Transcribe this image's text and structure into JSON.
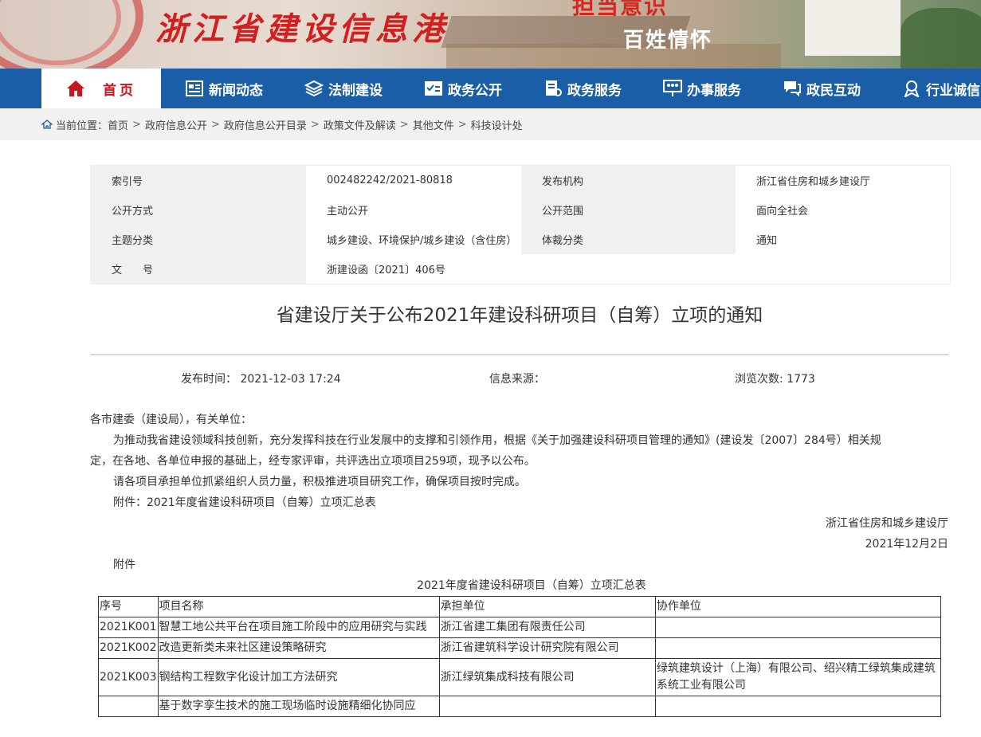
{
  "site": {
    "title": "浙江省建设信息港",
    "slogan_top": "担当意识",
    "slogan_bottom": "百姓情怀"
  },
  "nav": {
    "items": [
      {
        "label": "首页",
        "icon": "home-icon",
        "active": true
      },
      {
        "label": "新闻动态",
        "icon": "newspaper-icon"
      },
      {
        "label": "法制建设",
        "icon": "layers-icon"
      },
      {
        "label": "政务公开",
        "icon": "checklist-icon"
      },
      {
        "label": "政务服务",
        "icon": "document-icon"
      },
      {
        "label": "办事服务",
        "icon": "people-icon"
      },
      {
        "label": "政民互动",
        "icon": "chat-icon"
      },
      {
        "label": "行业诚信",
        "icon": "badge-icon"
      }
    ]
  },
  "breadcrumb": {
    "prefix": "当前位置：",
    "items": [
      "首页",
      "政府信息公开",
      "政府信息公开目录",
      "政策文件及解读",
      "其他文件",
      "科技设计处"
    ]
  },
  "meta": {
    "index_label": "索引号",
    "index_value": "002482242/2021-80818",
    "org_label": "发布机构",
    "org_value": "浙江省住房和城乡建设厅",
    "mode_label": "公开方式",
    "mode_value": "主动公开",
    "scope_label": "公开范围",
    "scope_value": "面向全社会",
    "topic_label": "主题分类",
    "topic_value": "城乡建设、环境保护/城乡建设（含住房）",
    "genre_label": "体裁分类",
    "genre_value": "通知",
    "docno_label": "文　　号",
    "docno_value": "浙建设函〔2021〕406号"
  },
  "article": {
    "title": "省建设厅关于公布2021年建设科研项目（自筹）立项的通知",
    "publish_time": "发布时间： 2021-12-03 17:24",
    "source": "信息来源：",
    "views": "浏览次数: 1773",
    "greeting": "各市建委（建设局），有关单位：",
    "p1a": "为推动我省建设领域科技创新，充分发挥科技在行业发展中的支撑和引领作用，根据《关于加强建设科研项目管理的通知》(建设发〔2007〕284号）相关规",
    "p1b": "定，在各地、各单位申报的基础上，经专家评审，共评选出立项项目259项，现予以公布。",
    "p2": "请各项目承担单位抓紧组织人员力量，积极推进项目研究工作，确保项目按时完成。",
    "p3": "附件：2021年度省建设科研项目（自筹）立项汇总表",
    "signature": "浙江省住房和城乡建设厅",
    "date": "2021年12月2日",
    "attachment_label": "附件",
    "table_caption": "2021年度省建设科研项目（自筹）立项汇总表"
  },
  "table": {
    "headers": [
      "序号",
      "项目名称",
      "承担单位",
      "协作单位"
    ],
    "rows": [
      [
        "2021K001",
        "智慧工地公共平台在项目施工阶段中的应用研究与实践",
        "浙江省建工集团有限责任公司",
        ""
      ],
      [
        "2021K002",
        "改造更新类未来社区建设策略研究",
        "浙江省建筑科学设计研究院有限公司",
        ""
      ],
      [
        "2021K003",
        "钢结构工程数字化设计加工方法研究",
        "浙江绿筑集成科技有限公司",
        "绿筑建筑设计（上海）有限公司、绍兴精工绿筑集成建筑系统工业有限公司"
      ],
      [
        "",
        "基于数字孪生技术的施工现场临时设施精细化协同应",
        "",
        ""
      ]
    ]
  },
  "colors": {
    "nav_bg": "#1b5ea8",
    "home_active": "#c8161d",
    "title_red": "#d21f1f"
  }
}
